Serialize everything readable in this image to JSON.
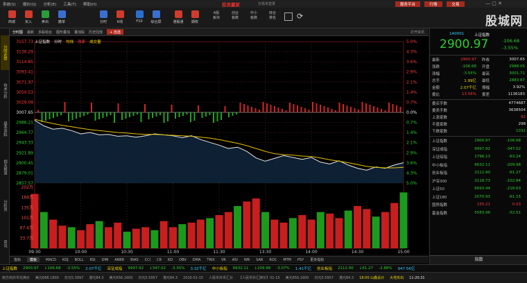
{
  "menu": {
    "items": [
      "系统(S)",
      "报价(Q)",
      "分析(E)",
      "工具(T)",
      "帮助(H)"
    ],
    "brand": "投资赢家",
    "sub": "交易未登录",
    "buttons": [
      "服务平台",
      "行情",
      "交易"
    ]
  },
  "toolbar": {
    "items": [
      {
        "label": "商城",
        "color": "#d03b2b"
      },
      {
        "label": "买入",
        "color": "#d03b2b"
      },
      {
        "label": "卖出",
        "color": "#2a9d3a"
      },
      {
        "label": "撤单",
        "color": "#3a6fd0"
      },
      {
        "label": "分时",
        "color": "#3a6fd0"
      },
      {
        "label": "K线",
        "color": "#d03b2b"
      },
      {
        "label": "F10",
        "color": "#2a6fd0"
      },
      {
        "label": "综合屏",
        "color": "#3a6fd0"
      },
      {
        "label": "港股通",
        "color": "#d03b2b"
      },
      {
        "label": "期权",
        "color": "#d03b2b"
      }
    ],
    "texts": [
      "A股\n板块",
      "创业\n板数",
      "中小\n板数",
      "综合\n排名"
    ],
    "logo": "股城网"
  },
  "tabs": {
    "items": [
      "分时图",
      "最新",
      "多股组合",
      "图形叠加",
      "叠加股",
      "历史回放"
    ],
    "add": "+ 自选",
    "zoom": "打开资讯"
  },
  "left_tabs": [
    "分时走势",
    "技术分析",
    "基本资料",
    "相关报道",
    "分析员",
    "资讯"
  ],
  "legend": {
    "name": "上证指数",
    "t1": "分时",
    "t2": "均线",
    "t3": "涨家",
    "t4": "成交量"
  },
  "chart_data": {
    "type": "line",
    "title": "上证指数 分时",
    "prev_close": 3007.65,
    "y_ticks": [
      "3157.73",
      "3136.29",
      "3114.85",
      "3093.41",
      "3071.97",
      "3050.53",
      "3029.09",
      "3007.65",
      "2986.21",
      "2964.77",
      "2943.33",
      "2921.89",
      "2900.45",
      "2879.01",
      "2857.57"
    ],
    "pct_ticks": [
      "5.0%",
      "4.3%",
      "3.6%",
      "2.9%",
      "2.1%",
      "1.4%",
      "0.7%",
      "0.0%",
      "0.7%",
      "1.4%",
      "2.1%",
      "2.9%",
      "3.6%",
      "4.3%",
      "5.0%"
    ],
    "vol_ticks": [
      "202万",
      "169万",
      "135万",
      "101万",
      "67.4万",
      "33.7万"
    ],
    "x_ticks": [
      "09:30",
      "10:00",
      "10:30",
      "11:00",
      "11:30",
      "13:30",
      "14:00",
      "14:30",
      "15:00"
    ],
    "x": [
      0,
      6,
      12,
      18,
      24,
      30,
      36,
      42,
      48,
      54,
      60,
      66,
      72,
      78,
      84,
      90,
      96,
      102,
      108,
      114,
      120,
      126,
      132,
      138,
      144,
      150,
      156,
      162,
      168,
      174,
      180,
      186,
      192,
      198,
      204,
      210,
      216,
      222,
      228,
      234,
      240
    ],
    "price": [
      2991,
      2979,
      2972,
      2974,
      2969,
      2962,
      2965,
      2960,
      2961,
      2957,
      2958,
      2955,
      2958,
      2962,
      2960,
      2958,
      2954,
      2958,
      2950,
      2944,
      2938,
      2931,
      2934,
      2925,
      2911,
      2904,
      2910,
      2916,
      2912,
      2908,
      2912,
      2902,
      2898,
      2905,
      2896,
      2889,
      2885,
      2892,
      2889,
      2896,
      2901
    ],
    "avg": [
      2993,
      2988,
      2984,
      2980,
      2977,
      2974,
      2971,
      2969,
      2967,
      2965,
      2964,
      2962,
      2961,
      2961,
      2960,
      2959,
      2958,
      2957,
      2955,
      2953,
      2950,
      2946,
      2942,
      2937,
      2931,
      2925,
      2920,
      2918,
      2917,
      2915,
      2914,
      2911,
      2907,
      2904,
      2901,
      2897,
      2893,
      2891,
      2890,
      2890,
      2891
    ],
    "volume": [
      180,
      120,
      95,
      75,
      70,
      60,
      80,
      90,
      70,
      85,
      55,
      65,
      70,
      60,
      90,
      70,
      80,
      85,
      95,
      100,
      110,
      120,
      140,
      155,
      165,
      120,
      95,
      85,
      100,
      110,
      95,
      120,
      115,
      100,
      125,
      140,
      130,
      105,
      120,
      150,
      185
    ]
  },
  "indicators": [
    "指标",
    "模板",
    "MACD",
    "KDJ",
    "BOLL",
    "RSI",
    "DMI",
    "ARBR",
    "BIAS",
    "CCI",
    "CR",
    "KD",
    "OBV",
    "DMA",
    "TRIX",
    "VR",
    "ASI",
    "WR",
    "SAR",
    "ROC",
    "MTM",
    "PSY",
    "更多指标"
  ],
  "ticker": [
    {
      "name": "上证指数",
      "val": "2900.97",
      "chg": "↓106.68",
      "pct": "-3.55%",
      "amt": "2.07千亿"
    },
    {
      "name": "深证成指",
      "val": "9997.92",
      "chg": "↓347.02",
      "pct": "-3.35%",
      "amt": "3.32千亿"
    },
    {
      "name": "中小板指",
      "val": "6632.11",
      "chg": "↓209.98",
      "pct": "-3.07%",
      "amt": "1.41千亿"
    },
    {
      "name": "创业板指",
      "val": "2112.90",
      "chg": "↓61.27",
      "pct": "-2.88%",
      "amt": "947.56亿"
    }
  ],
  "status": {
    "items": [
      "南方商外币兑换价",
      "美元688.1800",
      "日元5.3997",
      "港元84.3",
      "美元656.1600",
      "日元5.5957",
      "港元84.3",
      "2016-01-15",
      "人民币外币汇价",
      "【人民币外汇牌价】01-15",
      "美元656.1600",
      "日元5.5957",
      "港元84.3"
    ],
    "brand": "18:00 山鑫设计",
    "brand2": "大宅实出",
    "time": "11:20:31"
  },
  "side": {
    "code": "1A0001",
    "name": "上证指数",
    "price": "2900.97",
    "chg": "-106.68",
    "pct": "-3.55%",
    "quote": [
      [
        "最新",
        "2900.97",
        "red",
        "昨收",
        "3007.65",
        "white"
      ],
      [
        "涨跌",
        "-106.68",
        "green",
        "开盘",
        "2988.05",
        "green"
      ],
      [
        "涨幅",
        "-3.55%",
        "green",
        "最高",
        "3001.71",
        "green"
      ],
      [
        "总手",
        "1.99亿",
        "yellow",
        "最低",
        "2883.87",
        "green"
      ],
      [
        "金额",
        "2.07千亿",
        "yellow",
        "振幅",
        "3.92%",
        "white"
      ],
      [
        "委比",
        "13.56%",
        "red",
        "委差",
        "1136183",
        "white"
      ]
    ],
    "stats": [
      [
        "委买手数",
        "4774687",
        "white"
      ],
      [
        "委卖手数",
        "3638504",
        "white"
      ],
      [
        "上涨家数",
        "92",
        "red"
      ],
      [
        "平盘家数",
        "298",
        "white"
      ],
      [
        "下跌家数",
        "1031",
        "green"
      ]
    ],
    "indices": [
      [
        "上证指数",
        "2900.97",
        "-106.68"
      ],
      [
        "深证成指",
        "9997.92",
        "-347.02"
      ],
      [
        "上证综指",
        "1796.13",
        "-63.24"
      ],
      [
        "中小板指",
        "6632.11",
        "-209.98"
      ],
      [
        "创业板指",
        "2112.90",
        "-61.27"
      ],
      [
        "沪深300",
        "3118.73",
        "-102.84"
      ],
      [
        "上证50",
        "6693.44",
        "-218.63"
      ],
      [
        "上证180",
        "2070.93",
        "-61.15"
      ],
      [
        "国债指数",
        "155.21",
        "0.03"
      ],
      [
        "基金指数",
        "5583.96",
        "-52.51"
      ]
    ],
    "bottom_tab": "指数"
  }
}
